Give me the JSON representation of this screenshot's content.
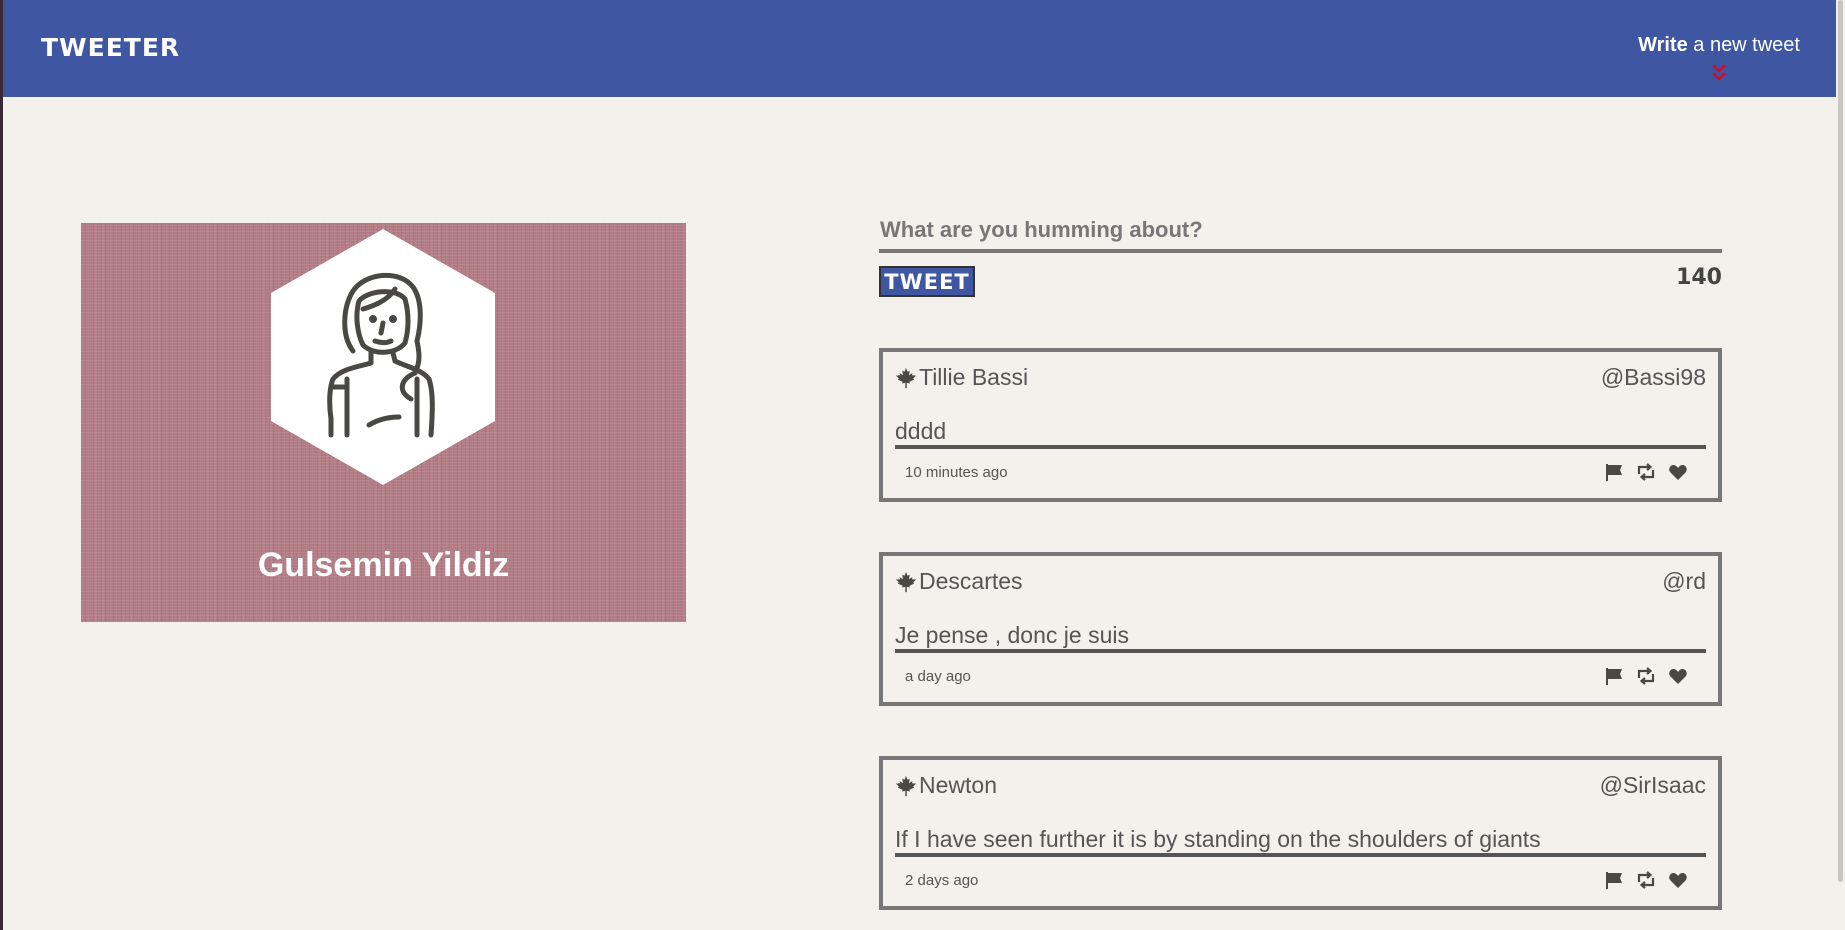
{
  "header": {
    "logo": "TWEETER",
    "compose_toggle": {
      "bold": "Write",
      "rest": " a new tweet",
      "icon": "double-chevron-down-icon",
      "icon_color": "#c8102e"
    },
    "bg_color": "#3f56a2"
  },
  "profile": {
    "name": "Gulsemin Yildiz",
    "avatar_icon": "woman-avatar-icon",
    "bg_color": "#b27c85"
  },
  "compose": {
    "placeholder": "What are you humming about?",
    "button_label": "TWEET",
    "counter": "140"
  },
  "tweets": [
    {
      "author": "Tillie Bassi",
      "handle": "@Bassi98",
      "text": "dddd",
      "time": "10 minutes ago",
      "author_icon": "maple-leaf-icon",
      "actions": [
        "flag-icon",
        "retweet-icon",
        "heart-icon"
      ]
    },
    {
      "author": "Descartes",
      "handle": "@rd",
      "text": "Je pense , donc je suis",
      "time": "a day ago",
      "author_icon": "maple-leaf-icon",
      "actions": [
        "flag-icon",
        "retweet-icon",
        "heart-icon"
      ]
    },
    {
      "author": "Newton",
      "handle": "@SirIsaac",
      "text": "If I have seen further it is by standing on the shoulders of giants",
      "time": "2 days ago",
      "author_icon": "maple-leaf-icon",
      "actions": [
        "flag-icon",
        "retweet-icon",
        "heart-icon"
      ]
    }
  ]
}
